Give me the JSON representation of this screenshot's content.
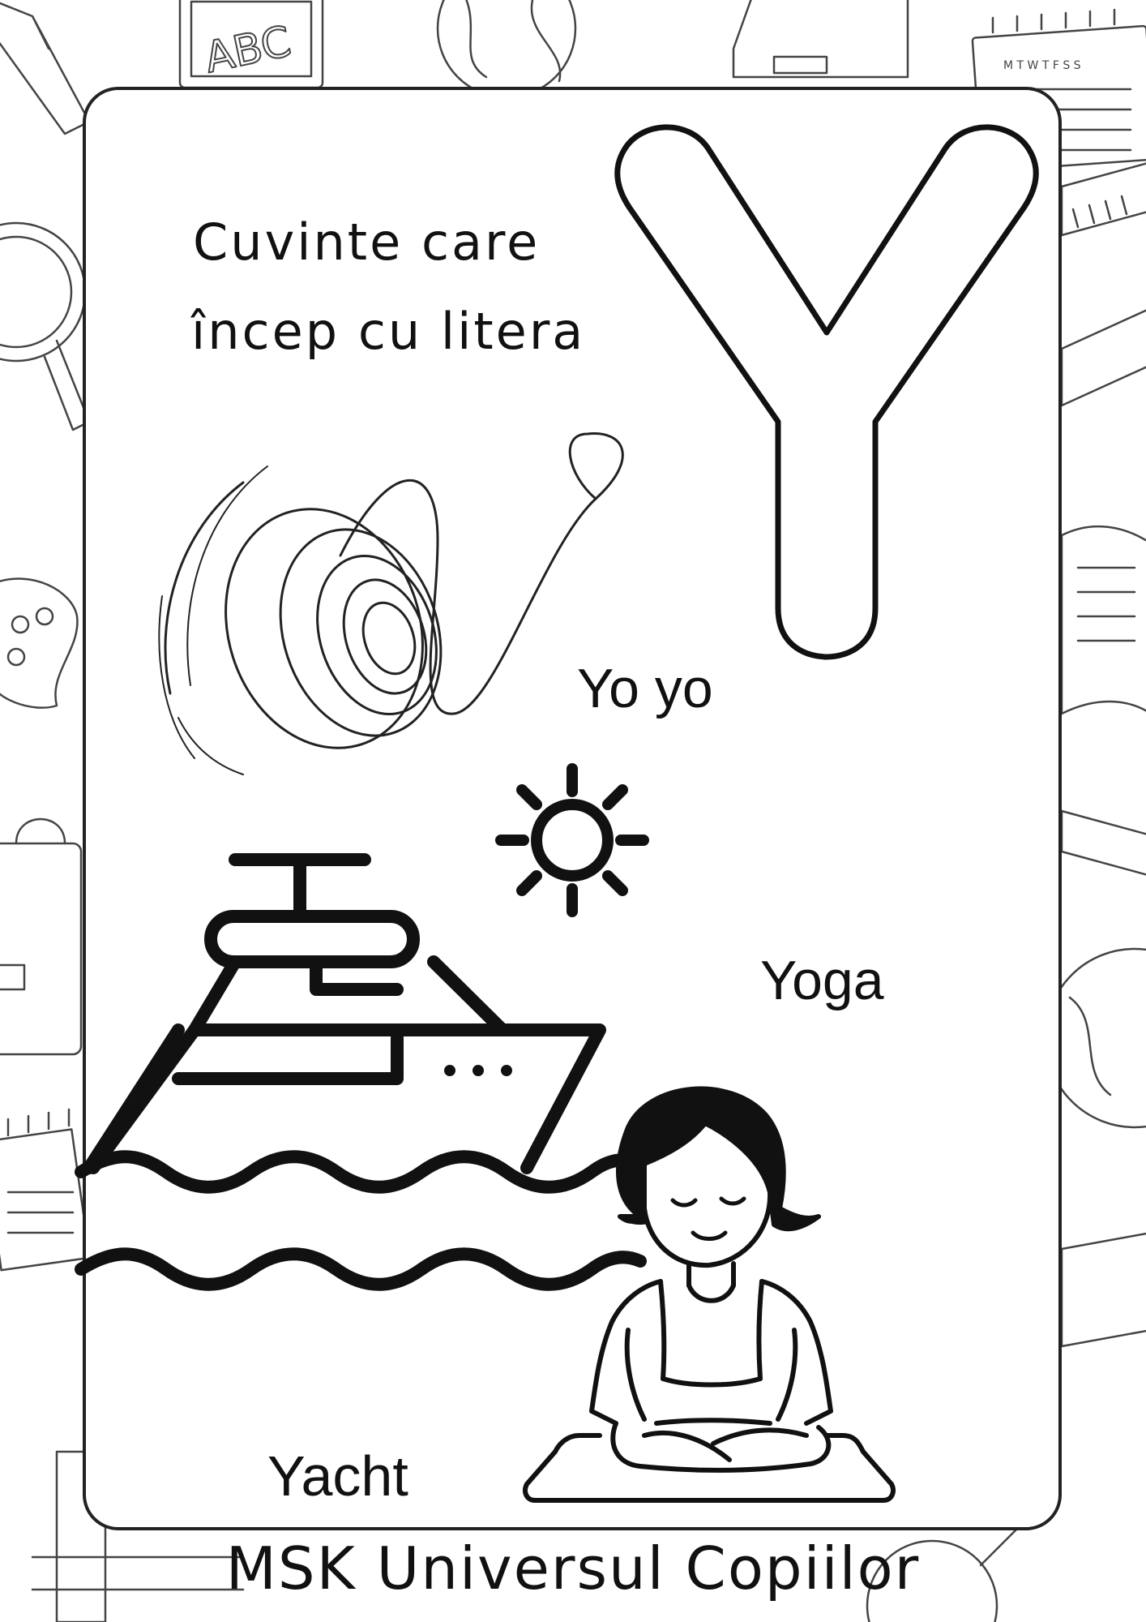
{
  "worksheet": {
    "heading_line1": "Cuvinte care",
    "heading_line2": "încep cu litera",
    "letter": "Y",
    "words": {
      "yoyo": "Yo yo",
      "yoga": "Yoga",
      "yacht": "Yacht"
    },
    "footer": "MSK Universul Copiilor"
  },
  "background": {
    "chalkboard_text": "ABC",
    "calendar_header": "M T W T F S S"
  },
  "colors": {
    "ink": "#111111",
    "paper": "#ffffff",
    "doodle_line": "#444444"
  }
}
